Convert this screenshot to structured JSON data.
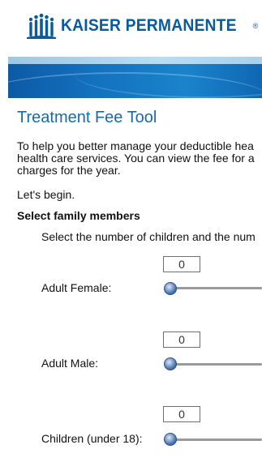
{
  "header": {
    "logo_text": "KAISER PERMANENTE",
    "registered_mark": "®",
    "logo_icon": "kp-logo-icon"
  },
  "main": {
    "title": "Treatment Fee Tool",
    "intro_lines": [
      "To help you better manage your deductible hea",
      "health care services. You can view the fee for a",
      "charges for the year."
    ],
    "lets_begin": "Let's begin.",
    "section_title": "Select family members",
    "section_desc": "Select the number of children and the num",
    "members": [
      {
        "label": "Adult Female:",
        "value": "0"
      },
      {
        "label": "Adult Male:",
        "value": "0"
      },
      {
        "label": "Children (under 18):",
        "value": "0"
      }
    ]
  },
  "colors": {
    "brand_blue": "#0a5a9c",
    "title_blue": "#1a6aa9",
    "banner_blue": "#1372bf"
  }
}
